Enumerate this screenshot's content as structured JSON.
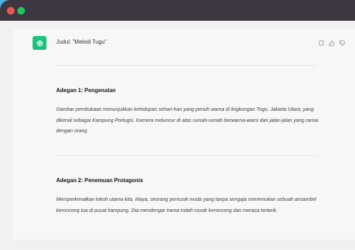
{
  "window": {
    "controls": [
      "close",
      "maximize"
    ]
  },
  "message": {
    "title": "Judul: \"Melodi Tugu\"",
    "avatar_icon": "openai-logo-icon",
    "actions": [
      "copy-icon",
      "thumbs-up-icon",
      "thumbs-down-icon"
    ],
    "sections": [
      {
        "heading": "Adegan 1: Pengenalan",
        "body": "Gambar pembukaan menunjukkan kehidupan sehari-hari yang penuh warna di lingkungan Tugu, Jakarta Utara, yang dikenal sebagai Kampung Portugis. Kamera meluncur di atas rumah-rumah berwarna-warni dan jalan-jalan yang ramai dengan orang."
      },
      {
        "heading": "Adegan 2: Penemuan Protagonis",
        "body": "Memperkenalkan tokoh utama kita, Maya, seorang pemusik muda yang tanpa sengaja menemukan sebuah ansambel keroncong tua di pusat kampung. Dia mendengar irama indah musik keroncong dan merasa tertarik."
      }
    ]
  }
}
